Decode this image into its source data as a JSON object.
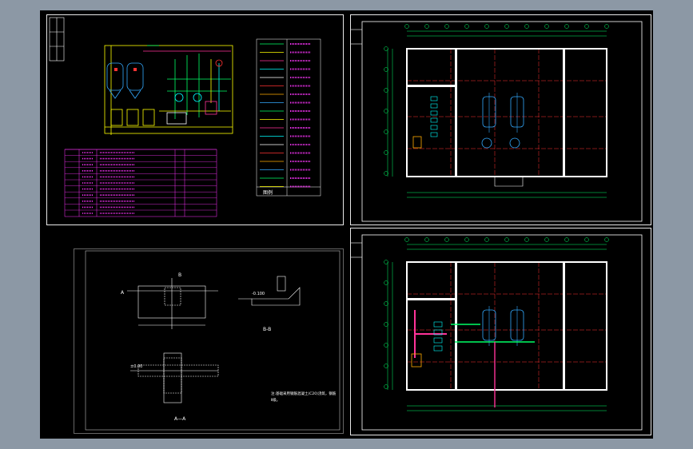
{
  "window": {
    "background": "#8c98a5",
    "canvas": "#000000"
  },
  "colors": {
    "frame": "#e8e8e8",
    "wall": "#ffffff",
    "grid": "#ff3333",
    "dim": "#00ff66",
    "pipe": "#ffff00",
    "equip": "#33aaff",
    "table": "#ff33ff",
    "cyan": "#00ffff",
    "pink": "#ff3399",
    "orange": "#ffaa00"
  },
  "sheets": [
    {
      "id": "flow-diagram",
      "content": "process flow schematic with legend and equipment table"
    },
    {
      "id": "plan-upper",
      "content": "equipment room plan"
    },
    {
      "id": "section-details",
      "content": "foundation sections A-A and B-B"
    },
    {
      "id": "plan-lower",
      "content": "equipment room piping plan"
    }
  ],
  "labels": {
    "section_bb_tag": "B-B",
    "section_aa_tag": "A—A",
    "plan_b": "B",
    "plan_a": "A",
    "elev_1": "-0.100",
    "elev_2": "±0.00",
    "sec_note": "注:基础采用钢筋混凝土(C20)浇筑，钢筋",
    "sec_note2": "Ⅱ级。",
    "legend_end": "图例"
  }
}
